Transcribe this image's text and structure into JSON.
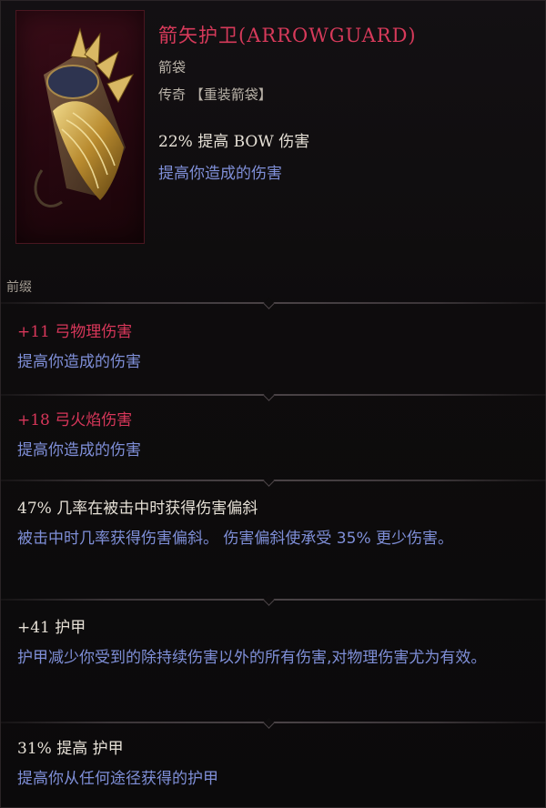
{
  "item": {
    "title": "箭矢护卫(ARROWGUARD)",
    "type": "箭袋",
    "rarity": "传奇 【重装箭袋】",
    "main_stat": "22% 提高 BOW 伤害",
    "main_desc": "提高你造成的伤害"
  },
  "section_label": "前缀",
  "affixes": [
    {
      "stat": "+11 弓物理伤害",
      "desc": "提高你造成的伤害"
    },
    {
      "stat": "+18 弓火焰伤害",
      "desc": "提高你造成的伤害"
    },
    {
      "stat": "47% 几率在被击中时获得伤害偏斜",
      "desc": "被击中时几率获得伤害偏斜。 伤害偏斜使承受 35% 更少伤害。"
    },
    {
      "stat": "+41 护甲",
      "desc": "护甲减少你受到的除持续伤害以外的所有伤害,对物理伤害尤为有效。"
    },
    {
      "stat": "31% 提高 护甲",
      "desc": "提高你从任何途径获得的护甲"
    }
  ],
  "colors": {
    "title": "#d63a5a",
    "implicit_stat": "#d8375a",
    "description": "#7f8fd8",
    "plain_stat": "#e6e0d6"
  },
  "icon": "quiver-icon"
}
